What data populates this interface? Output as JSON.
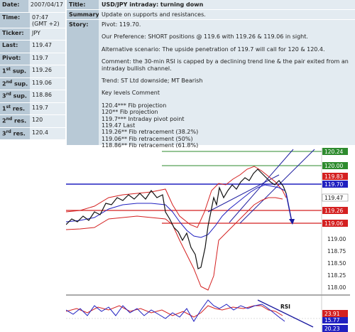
{
  "info": {
    "date_label": "Date:",
    "date_value": "2007/04/17",
    "time_label": "Time:",
    "time_value": "07:47 (GMT +2)",
    "ticker_label": "Ticker:",
    "ticker_value": "JPY",
    "last_label": "Last:",
    "last_value": "119.47",
    "pivot_label": "Pivot:",
    "pivot_value": "119.7",
    "sup1_num": "1",
    "sup1_suffix": "st",
    "sup1_word": " sup.",
    "sup1_value": "119.26",
    "sup2_num": "2",
    "sup2_suffix": "nd",
    "sup2_word": " sup.",
    "sup2_value": "119.06",
    "sup3_num": "3",
    "sup3_suffix": "rd",
    "sup3_word": " sup.",
    "sup3_value": "118.86",
    "res1_num": "1",
    "res1_suffix": "st",
    "res1_word": " res.",
    "res1_value": "119.7",
    "res2_num": "2",
    "res2_suffix": "nd",
    "res2_word": " res.",
    "res2_value": "120",
    "res3_num": "3",
    "res3_suffix": "rd",
    "res3_word": " res.",
    "res3_value": "120.4"
  },
  "article": {
    "title_label": "Title:",
    "title_value": "USD/JPY intraday: turning down",
    "summary_label": "Summary:",
    "summary_value": "Update on supports and resistances.",
    "story_label": "Story:",
    "story_lines": [
      "Pivot: 119.70.",
      "",
      "Our Preference: SHORT positions @ 119.6 with 119.26 & 119.06 in sight.",
      "",
      "Alternative scenario: The upside penetration of 119.7 will call for 120 & 120.4.",
      "",
      "Comment: the 30-min RSI is capped by a declining trend line & the pair exited from an",
      "intraday bullish channel.",
      "",
      "Trend: ST Ltd downside; MT Bearish",
      "",
      "Key levels Comment",
      "",
      "120.4*** Fib projection",
      "120** Fib projection",
      "119.7*** Intraday pivot point",
      "119.47 Last",
      "119.26** Fib retracement (38.2%)",
      "119.06** Fib retracement (50%)",
      "118.86** Fib retracement (61.8%)"
    ]
  },
  "chart": {
    "price_axis_labels": [
      "119.00",
      "118.75",
      "118.50",
      "118.25",
      "118.00"
    ],
    "level_tags": [
      {
        "value": "120.24",
        "color": "#2e8b2e"
      },
      {
        "value": "120.00",
        "color": "#2e8b2e"
      },
      {
        "value": "119.83",
        "color": "#d42020"
      },
      {
        "value": "119.70",
        "color": "#2020c0"
      },
      {
        "value": "119.47",
        "color": "#ffffff"
      },
      {
        "value": "119.26",
        "color": "#d42020"
      },
      {
        "value": "119.06",
        "color": "#d42020"
      }
    ],
    "rsi_label": "RSI",
    "rsi_tags": [
      {
        "value": "23.91",
        "color": "#d42020"
      },
      {
        "value": "15.77",
        "color": "#2020c0"
      },
      {
        "value": "20.23",
        "color": "#2020c0"
      }
    ]
  }
}
